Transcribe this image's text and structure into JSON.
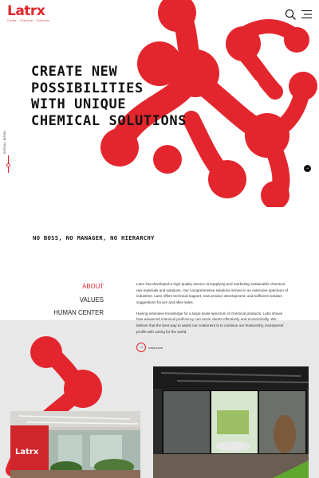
{
  "header": {
    "logo_text": "Latrx",
    "logo_subtitle": "Create · Chemical · Solutions",
    "icons": [
      "search-icon",
      "menu-icon"
    ]
  },
  "hero": {
    "title_lines": [
      "CREATE NEW",
      "POSSIBILITIES",
      "WITH UNIQUE",
      "CHEMICAL SOLUTIONS"
    ],
    "scroll_label": "SCROLL DOWN",
    "next_icon": "arrow-right-icon"
  },
  "tagline": "NO BOSS, NO MANAGER, NO HIERARCHY",
  "side_nav": {
    "items": [
      {
        "label": "ABOUT",
        "active": true
      },
      {
        "label": "VALUES",
        "active": false
      },
      {
        "label": "HUMAN CENTER",
        "active": false
      }
    ]
  },
  "about": {
    "paragraph1": "Latrx has developed a high-quality service at supplying and marketing sustainable chemical raw materials and solutions. Our comprehensive solutions served in an extensive spectrum of industries. Latrx offers technical support, new product development, and sufficient solution suggestions for pre and after-sales.",
    "paragraph2": "Having extensive knowledge for a large-scale spectrum of chemical products, Latrx shows how advanced chemical proficiency can serve clients effectively and economically. We believe that the best way to assist our customers is to continue our trustworthy, transparent profile with caring for the world.",
    "read_more": "read more"
  },
  "photos": {
    "office_sign": "Latrx"
  },
  "colors": {
    "accent": "#e1262c",
    "band": "#e8e8e8",
    "text": "#111111"
  }
}
